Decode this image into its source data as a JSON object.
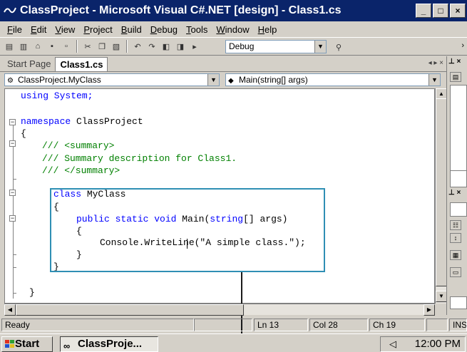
{
  "window": {
    "title": "ClassProject - Microsoft Visual C#.NET [design] - Class1.cs",
    "min": "_",
    "max": "□",
    "close": "×"
  },
  "menu": [
    {
      "label": "File",
      "key": "F",
      "rest": "ile"
    },
    {
      "label": "Edit",
      "key": "E",
      "rest": "dit"
    },
    {
      "label": "View",
      "key": "V",
      "rest": "iew"
    },
    {
      "label": "Project",
      "key": "P",
      "rest": "roject"
    },
    {
      "label": "Build",
      "key": "B",
      "rest": "uild"
    },
    {
      "label": "Debug",
      "key": "D",
      "rest": "ebug"
    },
    {
      "label": "Tools",
      "key": "T",
      "rest": "ools"
    },
    {
      "label": "Window",
      "key": "W",
      "rest": "indow"
    },
    {
      "label": "Help",
      "key": "H",
      "rest": "elp"
    }
  ],
  "toolbar": {
    "configuration": "Debug",
    "icons": [
      "new-project-icon",
      "add-item-icon",
      "open-icon",
      "save-icon",
      "save-all-icon",
      "cut-icon",
      "copy-icon",
      "paste-icon",
      "undo-icon",
      "redo-icon",
      "navigate-back-icon",
      "navigate-forward-icon",
      "run-icon",
      "find-icon"
    ]
  },
  "tabs": [
    {
      "label": "Start Page",
      "active": false
    },
    {
      "label": "Class1.cs",
      "active": true
    }
  ],
  "tab_controls": "◂ ▸ ×",
  "navbar": {
    "type_select": "ClassProject.MyClass",
    "member_select": "Main(string[] args)"
  },
  "code": {
    "l1": "using System;",
    "l2a": "namespace",
    "l2b": " ClassProject",
    "l3": "{",
    "l4": "/// <summary>",
    "l5": "/// Summary description for Class1.",
    "l6": "/// </summary>",
    "l7a": "class",
    "l7b": " MyClass",
    "l8": "{",
    "l9a": "public static void",
    "l9b": " Main(",
    "l9c": "string",
    "l9d": "[] args)",
    "l10": "{",
    "l11": "Console.WriteLine(\"A simple class.\");",
    "l12": "}",
    "l13": "}",
    "l14": "}"
  },
  "status": {
    "ready": "Ready",
    "line": "Ln 13",
    "col": "Col 28",
    "ch": "Ch 19",
    "ins": "INS"
  },
  "taskbar": {
    "start": "Start",
    "task": "ClassProje...",
    "clock": "12:00 PM"
  }
}
